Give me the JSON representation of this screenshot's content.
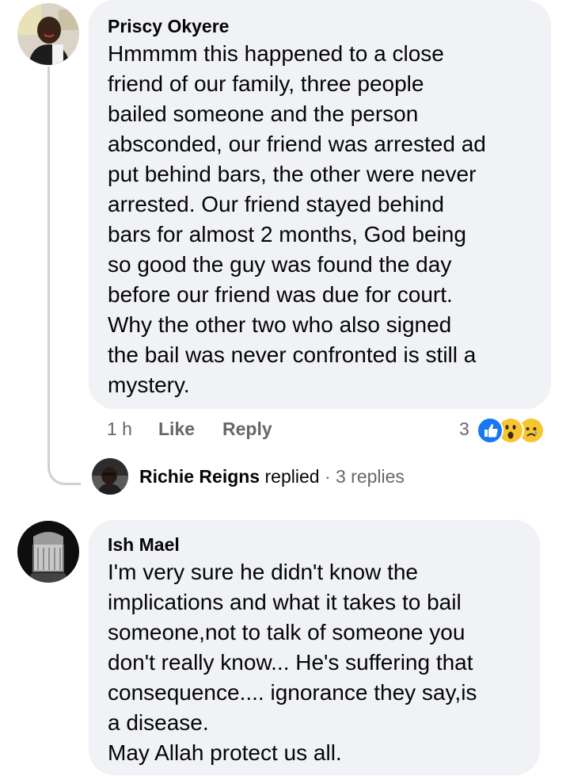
{
  "comments": [
    {
      "author": "Priscy Okyere",
      "text": "Hmmmm this happened to a close\nfriend of our family, three people\nbailed someone and the person\nabsconded, our friend was arrested ad\nput behind bars, the other were never\narrested. Our friend stayed behind\nbars for almost 2 months, God being\nso good the guy was found the day\nbefore our friend was due for court.\nWhy the other two who also signed\nthe bail was never confronted is still a\nmystery.",
      "time": "1 h",
      "like_label": "Like",
      "reply_label": "Reply",
      "reaction_count": "3",
      "reactions": [
        "like-icon",
        "wow-icon",
        "sad-icon"
      ],
      "reply_summary": {
        "author": "Richie Reigns",
        "action": "replied",
        "separator": "·",
        "count_label": "3 replies"
      }
    },
    {
      "author": "Ish Mael",
      "text": "I'm very sure he didn't know the\nimplications and what it takes to bail\nsomeone,not to talk of someone you\ndon't really know... He's suffering that\nconsequence.... ignorance they say,is\na disease.\nMay Allah protect us all."
    }
  ],
  "colors": {
    "bubble": "#f0f2f5",
    "meta_text": "#65676b",
    "like_blue": "#1877f2",
    "emoji_yellow": "#f7c531"
  }
}
